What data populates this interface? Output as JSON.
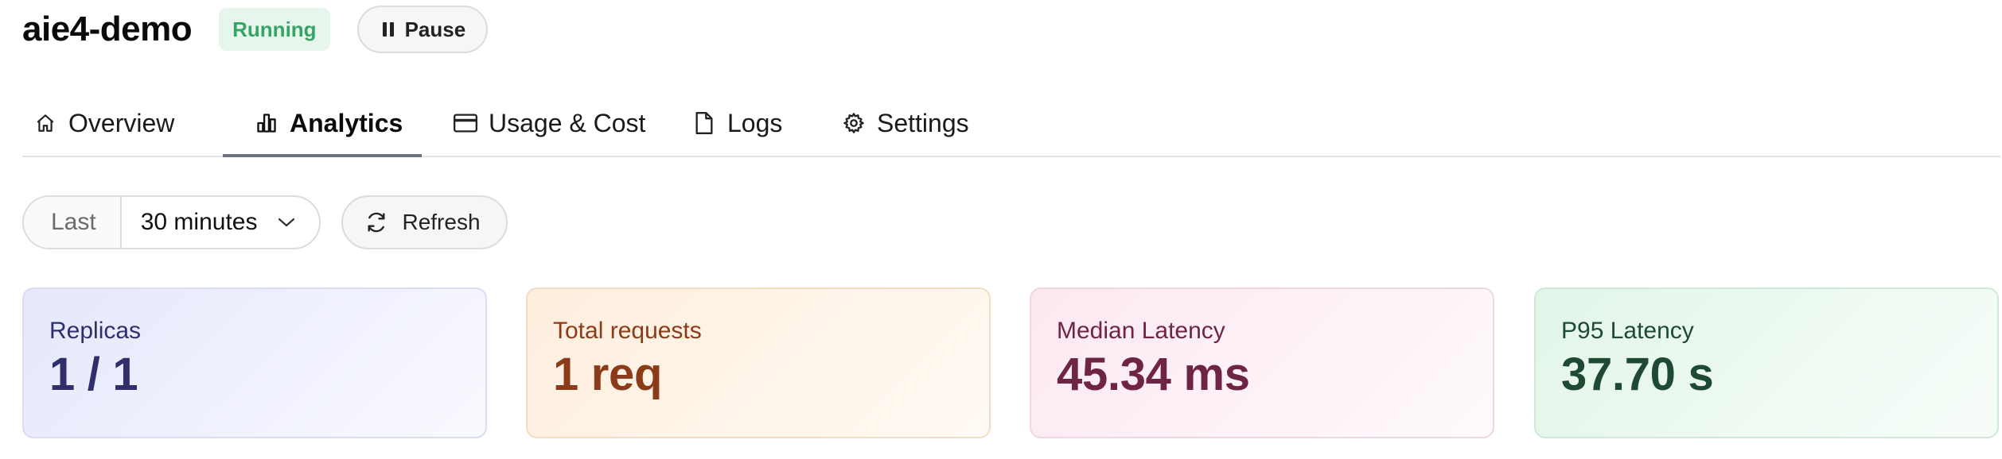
{
  "header": {
    "title": "aie4-demo",
    "status": "Running",
    "status_color": "#37a466",
    "pause_label": "Pause",
    "pause_icon": "pause-icon"
  },
  "tabs": [
    {
      "label": "Overview",
      "icon": "home-icon",
      "active": false
    },
    {
      "label": "Analytics",
      "icon": "bar-chart-icon",
      "active": true
    },
    {
      "label": "Usage & Cost",
      "icon": "credit-card-icon",
      "active": false
    },
    {
      "label": "Logs",
      "icon": "file-icon",
      "active": false
    },
    {
      "label": "Settings",
      "icon": "gear-icon",
      "active": false
    }
  ],
  "controls": {
    "range_prefix": "Last",
    "range_value": "30 minutes",
    "refresh_label": "Refresh"
  },
  "stats": [
    {
      "label": "Replicas",
      "value": "1 / 1",
      "accent": "#2f2f6b"
    },
    {
      "label": "Total requests",
      "value": "1 req",
      "accent": "#8a3b1a"
    },
    {
      "label": "Median Latency",
      "value": "45.34 ms",
      "accent": "#6e2445"
    },
    {
      "label": "P95 Latency",
      "value": "37.70 s",
      "accent": "#1e4a34"
    }
  ]
}
